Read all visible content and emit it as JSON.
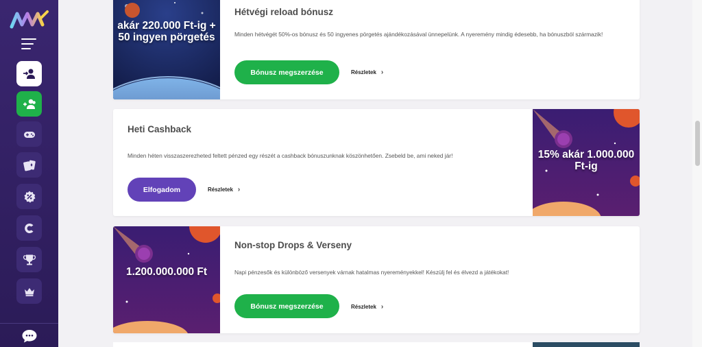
{
  "sidebar": {
    "items": [
      {
        "name": "login-icon"
      },
      {
        "name": "register-icon"
      },
      {
        "name": "games-icon"
      },
      {
        "name": "cards-icon"
      },
      {
        "name": "promotions-icon"
      },
      {
        "name": "casino-icon"
      },
      {
        "name": "trophy-icon"
      },
      {
        "name": "vip-crown-icon"
      }
    ],
    "chat_icon": "chat-icon"
  },
  "cards": [
    {
      "title": "Hétvégi reload bónusz",
      "description": "Minden hétvégét 50%-os bónusz és 50 ingyenes pörgetés ajándékozásával ünnepelünk. A nyeremény mindig édesebb, ha bónuszból származik!",
      "button": "Bónusz megszerzése",
      "details": "Részletek",
      "image_text": "akár 220.000 Ft-ig + 50 ingyen pörgetés"
    },
    {
      "title": "Heti Cashback",
      "description": "Minden héten visszaszerezheted feltett pénzed egy részét a cashback bónuszunknak köszönhetően. Zsebeld be, ami neked jár!",
      "button": "Elfogadom",
      "details": "Részletek",
      "image_text": "15% akár 1.000.000 Ft-ig"
    },
    {
      "title": "Non-stop Drops & Verseny",
      "description": "Napi pénzesők és különböző versenyek várnak hatalmas nyereményekkel! Készülj fel és élvezd a játékokat!",
      "button": "Bónusz megszerzése",
      "details": "Részletek",
      "image_text": "1.200.000.000 Ft"
    }
  ],
  "colors": {
    "sidebar": "#2b1b57",
    "green": "#1fb14a",
    "purple": "#6242b8"
  }
}
